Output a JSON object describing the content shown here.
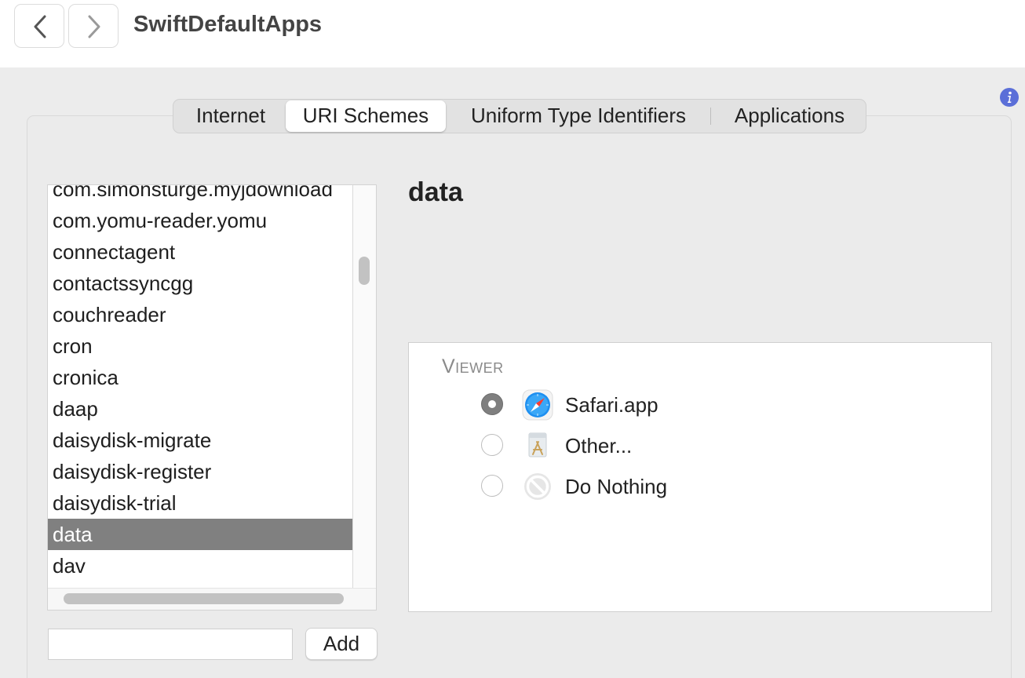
{
  "window": {
    "title": "SwiftDefaultApps"
  },
  "toolbar": {
    "back_icon": "chevron-left-icon",
    "forward_icon": "chevron-right-icon"
  },
  "tabs": [
    {
      "label": "Internet",
      "selected": false
    },
    {
      "label": "URI Schemes",
      "selected": true
    },
    {
      "label": "Uniform Type Identifiers",
      "selected": false
    },
    {
      "label": "Applications",
      "selected": false
    }
  ],
  "scheme_list": {
    "items": [
      "com.simonsturge.myjdownload",
      "com.yomu-reader.yomu",
      "connectagent",
      "contactssyncgg",
      "couchreader",
      "cron",
      "cronica",
      "daap",
      "daisydisk-migrate",
      "daisydisk-register",
      "daisydisk-trial",
      "data",
      "dav"
    ],
    "selected": "data"
  },
  "add_row": {
    "input_value": "",
    "button_label": "Add"
  },
  "detail": {
    "title": "data",
    "viewer_heading": "Viewer",
    "options": [
      {
        "label": "Safari.app",
        "icon": "safari-icon",
        "checked": true
      },
      {
        "label": "Other...",
        "icon": "app-store-icon",
        "checked": false
      },
      {
        "label": "Do Nothing",
        "icon": "prohibited-icon",
        "checked": false
      }
    ]
  },
  "colors": {
    "selection": "#808080",
    "info_icon": "#5b6fd8",
    "panel_bg": "#ebebeb"
  }
}
